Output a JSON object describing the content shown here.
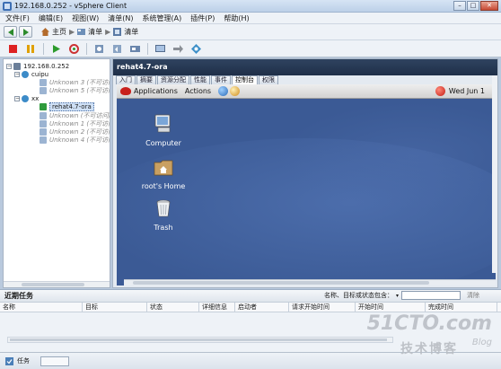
{
  "window": {
    "title": "192.168.0.252 - vSphere Client",
    "buttons": {
      "minimize": "–",
      "maximize": "□",
      "close": "✕"
    }
  },
  "menu": [
    "文件(F)",
    "编辑(E)",
    "视图(W)",
    "清单(N)",
    "系统管理(A)",
    "插件(P)",
    "帮助(H)"
  ],
  "breadcrumb": {
    "home": "主页",
    "sep1": "▶",
    "inventory1": "清单",
    "sep2": "▶",
    "inventory2": "清单"
  },
  "tree": {
    "root": "192.168.0.252",
    "pool1": "cuipu",
    "pool1_vms": [
      "Unknown 3 (不可访问)",
      "Unknown 5 (不可访问)"
    ],
    "pool2": "xx",
    "selected_vm": "rehat4.7-ora",
    "pool2_vms": [
      "Unknown (不可访问)",
      "Unknown 1 (不可访问)",
      "Unknown 2 (不可访问)",
      "Unknown 4 (不可访问)"
    ]
  },
  "main": {
    "vm_title": "rehat4.7-ora",
    "tabs": [
      "入门",
      "摘要",
      "资源分配",
      "性能",
      "事件",
      "控制台",
      "权限"
    ],
    "active_tab": "控制台"
  },
  "console": {
    "panel": {
      "applications": "Applications",
      "actions": "Actions",
      "clock": "Wed Jun 1"
    },
    "desktop_icons": [
      "Computer",
      "root's Home",
      "Trash"
    ]
  },
  "tasks": {
    "title": "近期任务",
    "filter_label": "名称、目标或状态包含：",
    "filter_dropdown": "▾",
    "filter_value": "",
    "clear_label": "清除",
    "columns": [
      "名称",
      "目标",
      "状态",
      "详细信息",
      "启动者",
      "请求开始时间",
      "开始时间",
      "完成时间"
    ]
  },
  "statusbar": {
    "label": "任务"
  },
  "watermark": {
    "big": "51CTO.com",
    "small": "技术博客",
    "blog": "Blog"
  },
  "colors": {
    "console_bg": "#3b5a95",
    "vm_title_bg": "#263a58",
    "accent": "#4a6fa5"
  }
}
